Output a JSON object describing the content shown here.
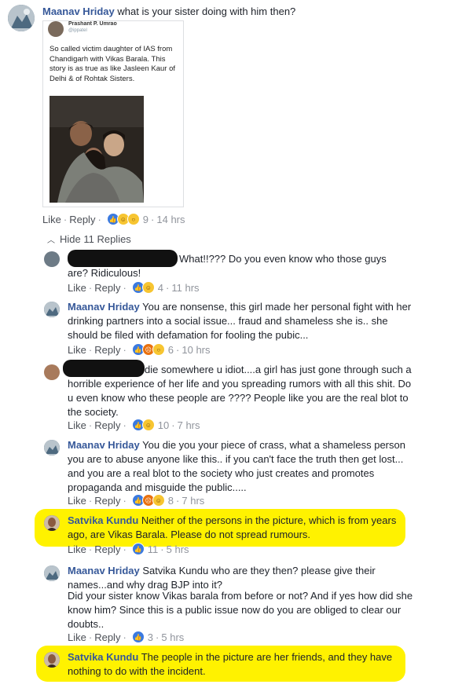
{
  "post": {
    "author": "Maanav Hriday",
    "text": "what is your sister doing with him then?",
    "embed": {
      "tweet_name": "Prashant P. Umrao",
      "tweet_handle": "@ippatel",
      "tweet_text": "So called victim daughter of IAS from Chandigarh with Vikas Barala. This story is as true as like Jasleen Kaur of Delhi & of Rohtak Sisters."
    },
    "actions": {
      "like": "Like",
      "reply": "Reply",
      "count": "9",
      "time": "14 hrs"
    }
  },
  "hide_replies": "Hide 11 Replies",
  "replies": [
    {
      "author": "",
      "text": "What!!??? Do you even know who those guys are? Ridiculous!",
      "like": "Like",
      "reply": "Reply",
      "count": "4",
      "time": "11 hrs"
    },
    {
      "author": "Maanav Hriday",
      "text": "You are nonsense, this girl made her personal fight with her drinking partners into a social issue... fraud and shameless she is.. she should be filed with defamation for fooling the pubic...",
      "like": "Like",
      "reply": "Reply",
      "count": "6",
      "time": "10 hrs"
    },
    {
      "author": "",
      "text": "die somewhere u idiot....a girl has just gone through such a horrible experience of her life and you spreading rumors with all this shit. Do u even know who these people are ???? People like you are the real blot to the society.",
      "like": "Like",
      "reply": "Reply",
      "count": "10",
      "time": "7 hrs"
    },
    {
      "author": "Maanav Hriday",
      "text": "You die you your piece of crass, what a shameless person you are to abuse anyone like this.. if you can't face the truth then get lost... and you are a real blot to the society who just creates and promotes propaganda and misguide the public.....",
      "like": "Like",
      "reply": "Reply",
      "count": "8",
      "time": "7 hrs"
    },
    {
      "author": "Satvika Kundu",
      "text": "Neither of the persons in the picture, which is from years ago, are Vikas Barala. Please do not spread rumours.",
      "like": "Like",
      "reply": "Reply",
      "count": "11",
      "time": "5 hrs"
    },
    {
      "author": "Maanav Hriday",
      "text": "Satvika Kundu who are they then? please give their names...and why drag BJP into it?",
      "text2": "Did your sister know Vikas barala from before or not? And if yes how did she know him? Since this is a public issue now do you are obliged to clear our doubts..",
      "like": "Like",
      "reply": "Reply",
      "count": "3",
      "time": "5 hrs"
    },
    {
      "author": "Satvika Kundu",
      "text": "The people in the picture are her friends, and they have nothing to do with the incident."
    }
  ],
  "colors": {
    "link": "#365899",
    "highlight": "#fff200",
    "meta": "#90949c"
  }
}
